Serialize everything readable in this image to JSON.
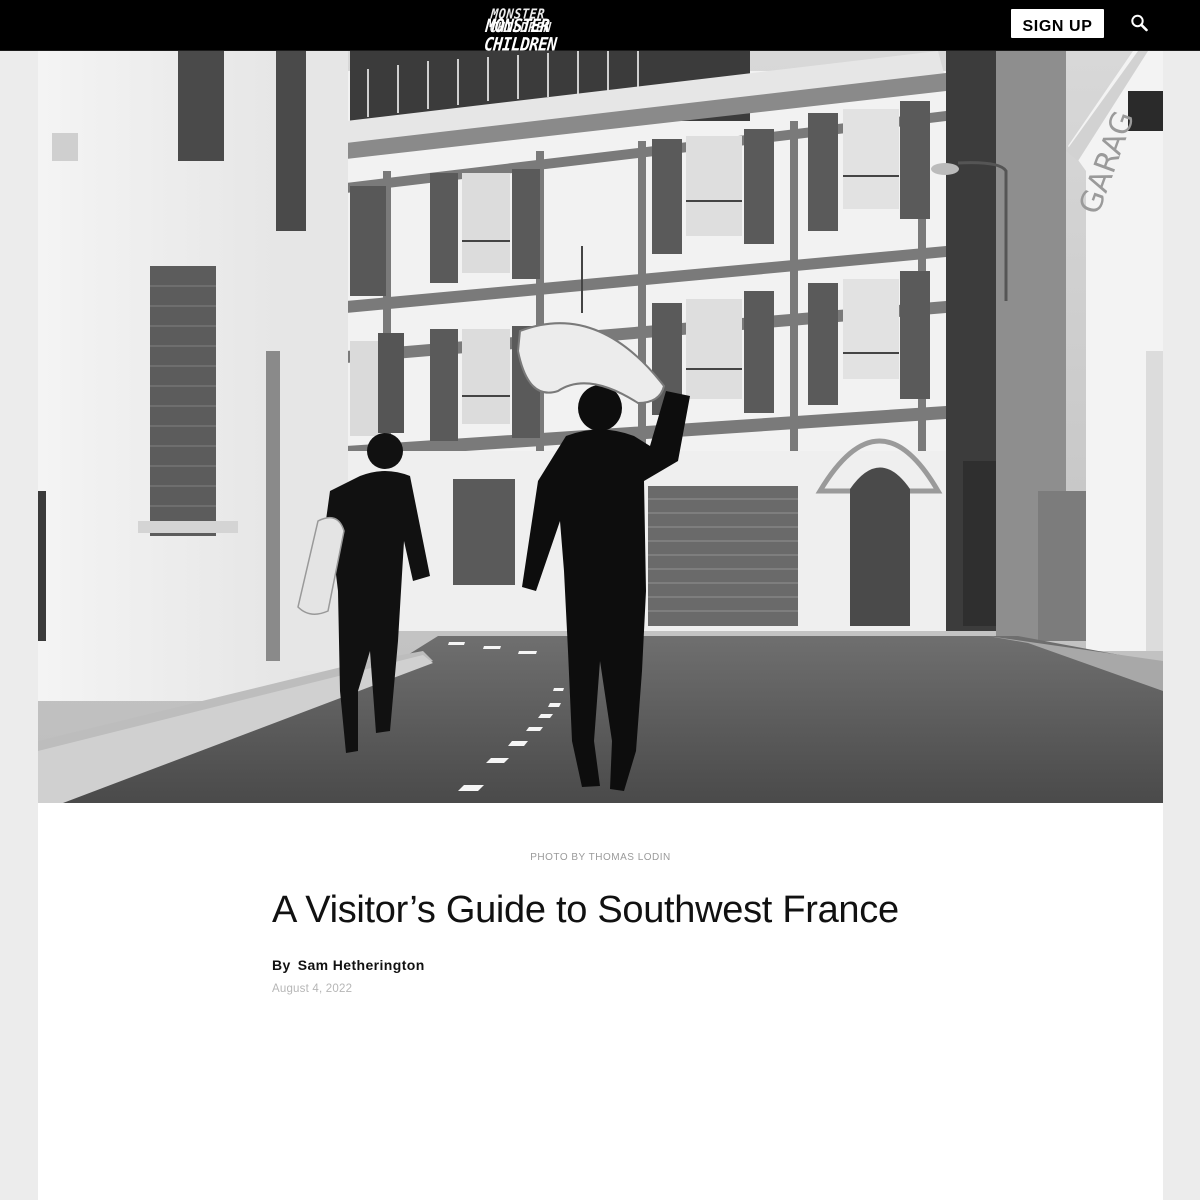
{
  "header": {
    "logo_line1": "MONSTER CHILDREN",
    "logo_line2": "MONSTER CHILDREN",
    "signup_label": "SIGN UP",
    "search_icon": "search-icon",
    "background": "#000000"
  },
  "hero": {
    "image_alt": "Black and white photo of two surfers in wetsuits carrying surfboards down a street between white buildings with wooden shutters",
    "style": "black-and-white photograph"
  },
  "article": {
    "photo_credit": "PHOTO BY THOMAS LODIN",
    "title": "A Visitor’s Guide to Southwest France",
    "by_label": "By",
    "author": "Sam Hetherington",
    "date": "August 4, 2022"
  },
  "colors": {
    "page_bg": "#ececec",
    "card_bg": "#ffffff",
    "caption": "#9a9a9a",
    "date": "#b6b6b6"
  }
}
